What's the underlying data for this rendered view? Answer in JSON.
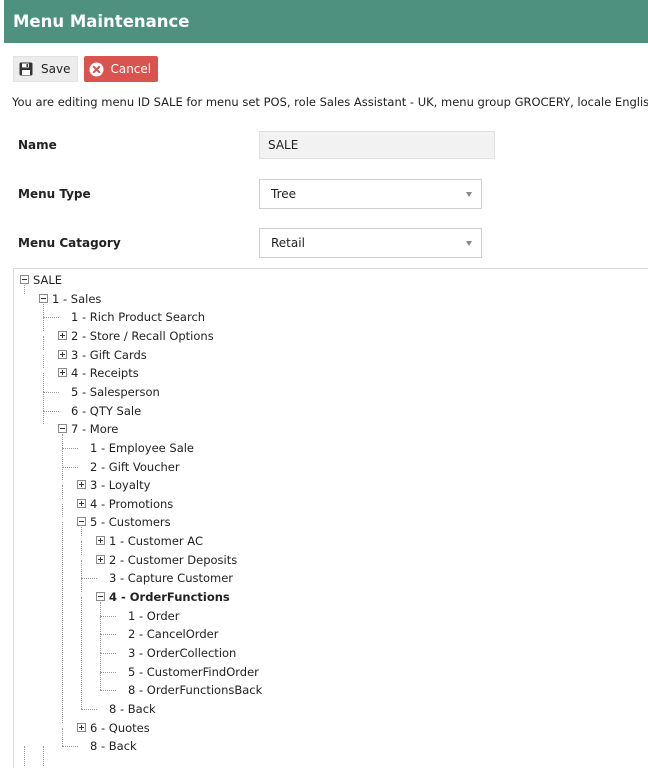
{
  "window": {
    "title": "Menu Maintenance"
  },
  "toolbar": {
    "save_label": "Save",
    "cancel_label": "Cancel"
  },
  "info_text": "You are editing menu ID SALE for menu set POS, role Sales Assistant - UK, menu group GROCERY, locale English (UK)",
  "form": {
    "name_label": "Name",
    "name_value": "SALE",
    "type_label": "Menu Type",
    "type_value": "Tree",
    "category_label": "Menu Catagory",
    "category_value": "Retail"
  },
  "colors": {
    "header": "#4e917f",
    "cancel": "#d9534f"
  },
  "tree": [
    {
      "label": "SALE",
      "toggle": "minus",
      "depth": 0
    },
    {
      "label": "1 - Sales",
      "toggle": "minus",
      "depth": 1
    },
    {
      "label": "1 - Rich Product Search",
      "toggle": "none",
      "depth": 2
    },
    {
      "label": "2 - Store / Recall Options",
      "toggle": "plus",
      "depth": 2
    },
    {
      "label": "3 - Gift Cards",
      "toggle": "plus",
      "depth": 2
    },
    {
      "label": "4 - Receipts",
      "toggle": "plus",
      "depth": 2
    },
    {
      "label": "5 - Salesperson",
      "toggle": "none",
      "depth": 2
    },
    {
      "label": "6 - QTY Sale",
      "toggle": "none",
      "depth": 2
    },
    {
      "label": "7 - More",
      "toggle": "minus",
      "depth": 2
    },
    {
      "label": "1 - Employee Sale",
      "toggle": "none",
      "depth": 3
    },
    {
      "label": "2 - Gift Voucher",
      "toggle": "none",
      "depth": 3
    },
    {
      "label": "3 - Loyalty",
      "toggle": "plus",
      "depth": 3
    },
    {
      "label": "4 - Promotions",
      "toggle": "plus",
      "depth": 3
    },
    {
      "label": "5 - Customers",
      "toggle": "minus",
      "depth": 3
    },
    {
      "label": "1 - Customer AC",
      "toggle": "plus",
      "depth": 4
    },
    {
      "label": "2 - Customer Deposits",
      "toggle": "plus",
      "depth": 4
    },
    {
      "label": "3 - Capture Customer",
      "toggle": "none",
      "depth": 4
    },
    {
      "label": "4 - OrderFunctions",
      "toggle": "minus",
      "depth": 4,
      "selected": true
    },
    {
      "label": "1 - Order",
      "toggle": "none",
      "depth": 5
    },
    {
      "label": "2 - CancelOrder",
      "toggle": "none",
      "depth": 5
    },
    {
      "label": "3 - OrderCollection",
      "toggle": "none",
      "depth": 5
    },
    {
      "label": "5 - CustomerFindOrder",
      "toggle": "none",
      "depth": 5
    },
    {
      "label": "8 - OrderFunctionsBack",
      "toggle": "none",
      "depth": 5
    },
    {
      "label": "8 - Back",
      "toggle": "none",
      "depth": 4
    },
    {
      "label": "6 - Quotes",
      "toggle": "plus",
      "depth": 3
    },
    {
      "label": "8 - Back",
      "toggle": "none",
      "depth": 3
    }
  ]
}
